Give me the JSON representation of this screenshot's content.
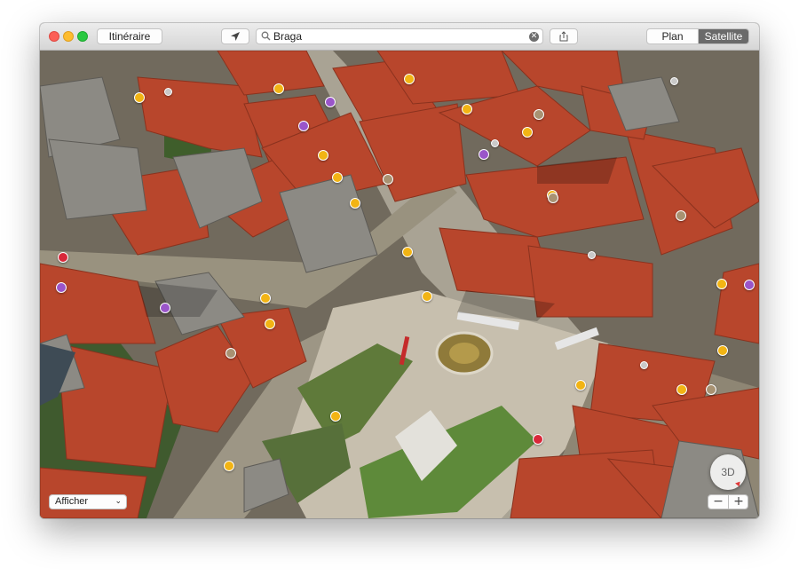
{
  "toolbar": {
    "itinerary_label": "Itinéraire",
    "search": {
      "value": "Braga",
      "placeholder": ""
    },
    "view_segments": [
      {
        "label": "Plan",
        "selected": false
      },
      {
        "label": "Satellite",
        "selected": true
      }
    ]
  },
  "map": {
    "mode": "satellite-3d",
    "compass_label": "3D",
    "show_menu": {
      "selected": "Afficher"
    },
    "zoom_out_label": "−",
    "zoom_in_label": "+"
  },
  "icons": {
    "close": "close-dot-icon",
    "minimize": "minimize-dot-icon",
    "zoom": "zoom-dot-icon",
    "location": "location-arrow-icon",
    "share": "share-icon",
    "search": "magnifier-icon",
    "clear": "clear-icon"
  },
  "colors": {
    "poi_yellow": "#f2b414",
    "poi_purple": "#9a55c9",
    "poi_red": "#d9283a",
    "roof_terracotta": "#b8462c",
    "selected_segment": "#6a6a6a"
  }
}
